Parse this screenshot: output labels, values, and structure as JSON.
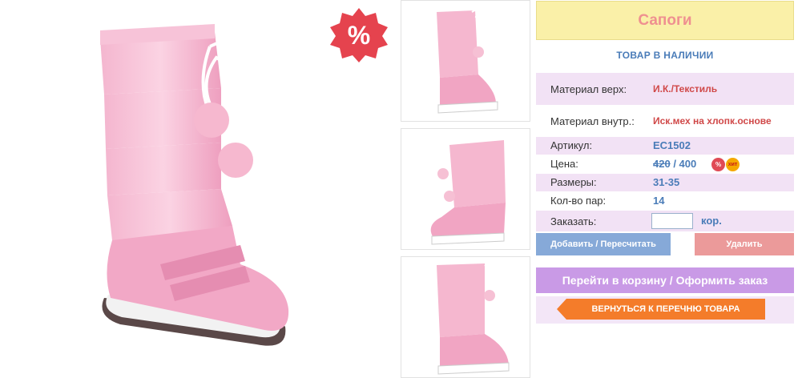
{
  "sale_badge": {
    "symbol": "%",
    "color": "#e5434e"
  },
  "product": {
    "title": "Сапоги",
    "availability": "ТОВАР В НАЛИЧИИ",
    "details": [
      {
        "label": "Материал верх:",
        "value": "И.К./Текстиль"
      },
      {
        "label": "Материал внутр.:",
        "value": "Иск.мех на хлопк.основе"
      },
      {
        "label": "Артикул:",
        "value": "EC1502"
      }
    ],
    "price": {
      "label": "Цена:",
      "old": "420",
      "separator": " / ",
      "current": "400",
      "sale_badge": "%",
      "hit_badge": "хит"
    },
    "sizes": {
      "label": "Размеры:",
      "value": "31-35"
    },
    "pairs": {
      "label": "Кол-во пар:",
      "value": "14"
    },
    "order": {
      "label": "Заказать:",
      "value": "",
      "unit": "кор."
    }
  },
  "buttons": {
    "update": "Добавить / Пересчитать",
    "delete": "Удалить",
    "checkout": "Перейти в корзину / Оформить заказ",
    "back": "ВЕРНУТЬСЯ К ПЕРЕЧНЮ ТОВАРА"
  },
  "colors": {
    "title_bg": "#faf0a8",
    "title_text": "#ef9090",
    "accent_blue": "#4a7cb8",
    "row_pink": "#f2e2f5",
    "checkout": "#c99ae6",
    "back": "#f47c2a"
  }
}
